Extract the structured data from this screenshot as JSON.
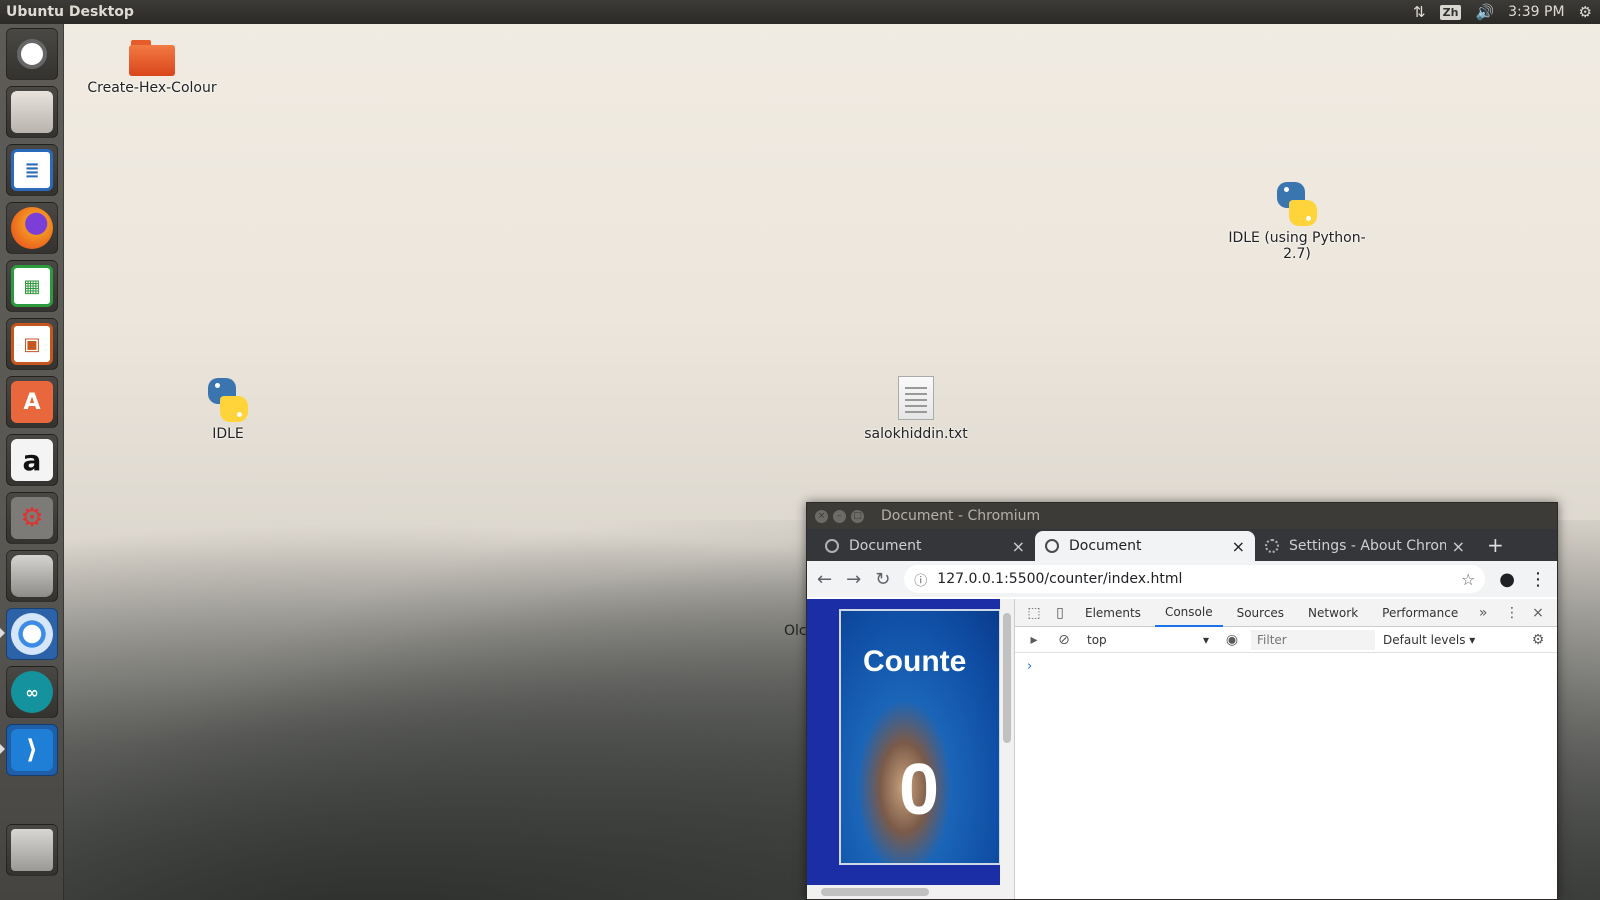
{
  "top_panel": {
    "title": "Ubuntu Desktop",
    "input_method": "Zh",
    "time": "3:39 PM"
  },
  "launcher": [
    {
      "name": "ubuntu-dash",
      "color": "#7a7773"
    },
    {
      "name": "files",
      "color": "#b8b4ad"
    },
    {
      "name": "libreoffice-writer",
      "color": "#2a6ab8"
    },
    {
      "name": "firefox",
      "color": "#e86a1e"
    },
    {
      "name": "libreoffice-calc",
      "color": "#2e9a3e"
    },
    {
      "name": "libreoffice-impress",
      "color": "#c4571f"
    },
    {
      "name": "ubuntu-software",
      "color": "#e9673c"
    },
    {
      "name": "amazon",
      "color": "#f4f4f4"
    },
    {
      "name": "system-settings",
      "color": "#8a8884"
    },
    {
      "name": "disks",
      "color": "#9e9c98"
    },
    {
      "name": "chromium",
      "color": "#3c8ce7"
    },
    {
      "name": "arduino",
      "color": "#14939e"
    },
    {
      "name": "vscode",
      "color": "#1f7ed6"
    },
    {
      "name": "trash",
      "color": "#a9a7a3"
    }
  ],
  "desktop": {
    "folder_label": "Create-Hex-Colour",
    "idle27_label": "IDLE (using Python-2.7)",
    "idle_label": "IDLE",
    "txt_label": "salokhiddin.txt",
    "stray_text": "Olc"
  },
  "chromium": {
    "window_title": "Document - Chromium",
    "tabs": [
      {
        "title": "Document",
        "active": false
      },
      {
        "title": "Document",
        "active": true
      },
      {
        "title": "Settings - About Chromium",
        "active": false
      }
    ],
    "url": "127.0.0.1:5500/counter/index.html",
    "page": {
      "heading": "Counte",
      "count": "0"
    },
    "devtools": {
      "tabs": [
        "Elements",
        "Console",
        "Sources",
        "Network",
        "Performance"
      ],
      "active_tab": "Console",
      "more": "»",
      "context": "top",
      "filter_placeholder": "Filter",
      "levels": "Default levels",
      "prompt": "›"
    }
  }
}
